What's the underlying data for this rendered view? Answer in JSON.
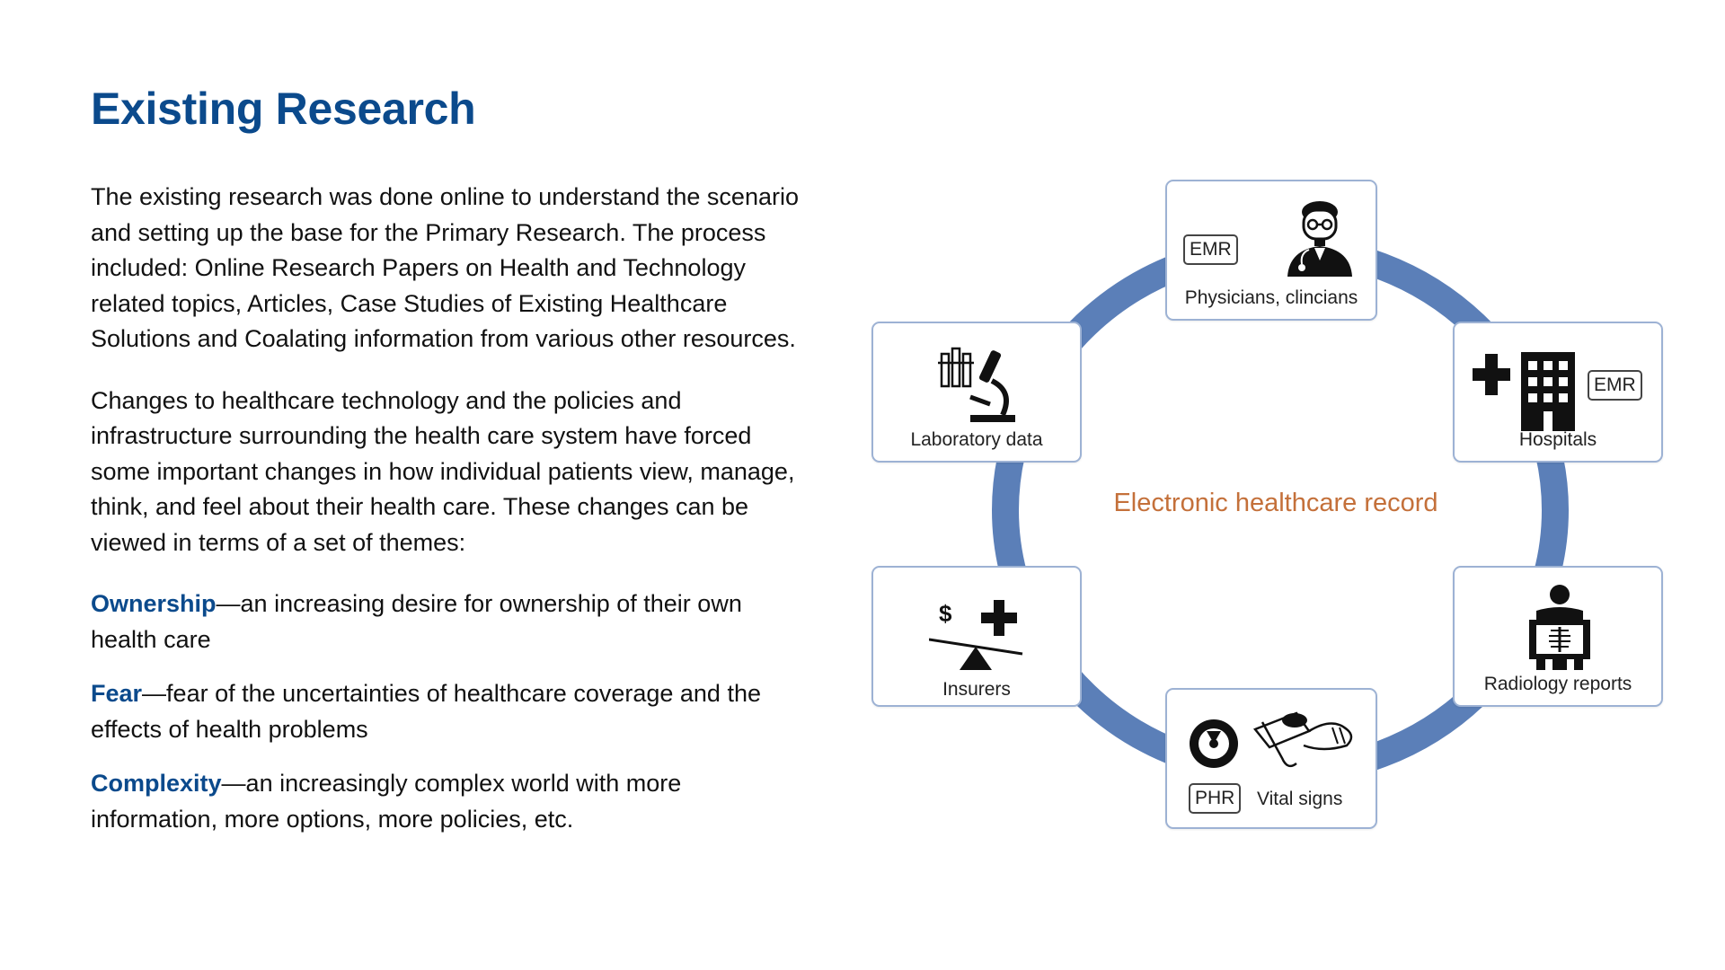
{
  "page": {
    "title": "Existing Research"
  },
  "content": {
    "paragraph1": "The existing research was done online to understand the scenario and setting up the base for the Primary Research.   The process included: Online Research Papers on Health and Technology related topics, Articles, Case Studies of Existing Healthcare Solutions and Coalating information from various other resources.",
    "paragraph2": "Changes to healthcare technology and the policies and infrastructure surrounding the health care system have forced some important changes in how individual patients view, manage, think, and feel about their health care. These changes can be viewed in terms of a set of themes:",
    "themes": [
      {
        "term": "Ownership",
        "text": "—an increasing desire for ownership of their own health care"
      },
      {
        "term": "Fear",
        "text": "—fear of the uncertainties of healthcare coverage and the effects of health problems"
      },
      {
        "term": "Complexity",
        "text": "—an increasingly complex world with more information, more options, more policies, etc."
      }
    ]
  },
  "diagram": {
    "center": "Electronic healthcare record",
    "ring_color": "#5b7fb8",
    "center_color": "#c4703a",
    "nodes": {
      "physicians": {
        "label": "Physicians, clincians",
        "badge": "EMR",
        "icon": "doctor-icon"
      },
      "laboratory": {
        "label": "Laboratory data",
        "icon": "microscope-icon"
      },
      "hospitals": {
        "label": "Hospitals",
        "badge": "EMR",
        "icon": "hospital-icon"
      },
      "insurers": {
        "label": "Insurers",
        "symbol": "$",
        "icon": "insurance-scale-icon"
      },
      "radiology": {
        "label": "Radiology reports",
        "icon": "xray-icon"
      },
      "vitals": {
        "label": "Vital signs",
        "badge": "PHR",
        "icon": "vital-signs-icon"
      }
    }
  }
}
